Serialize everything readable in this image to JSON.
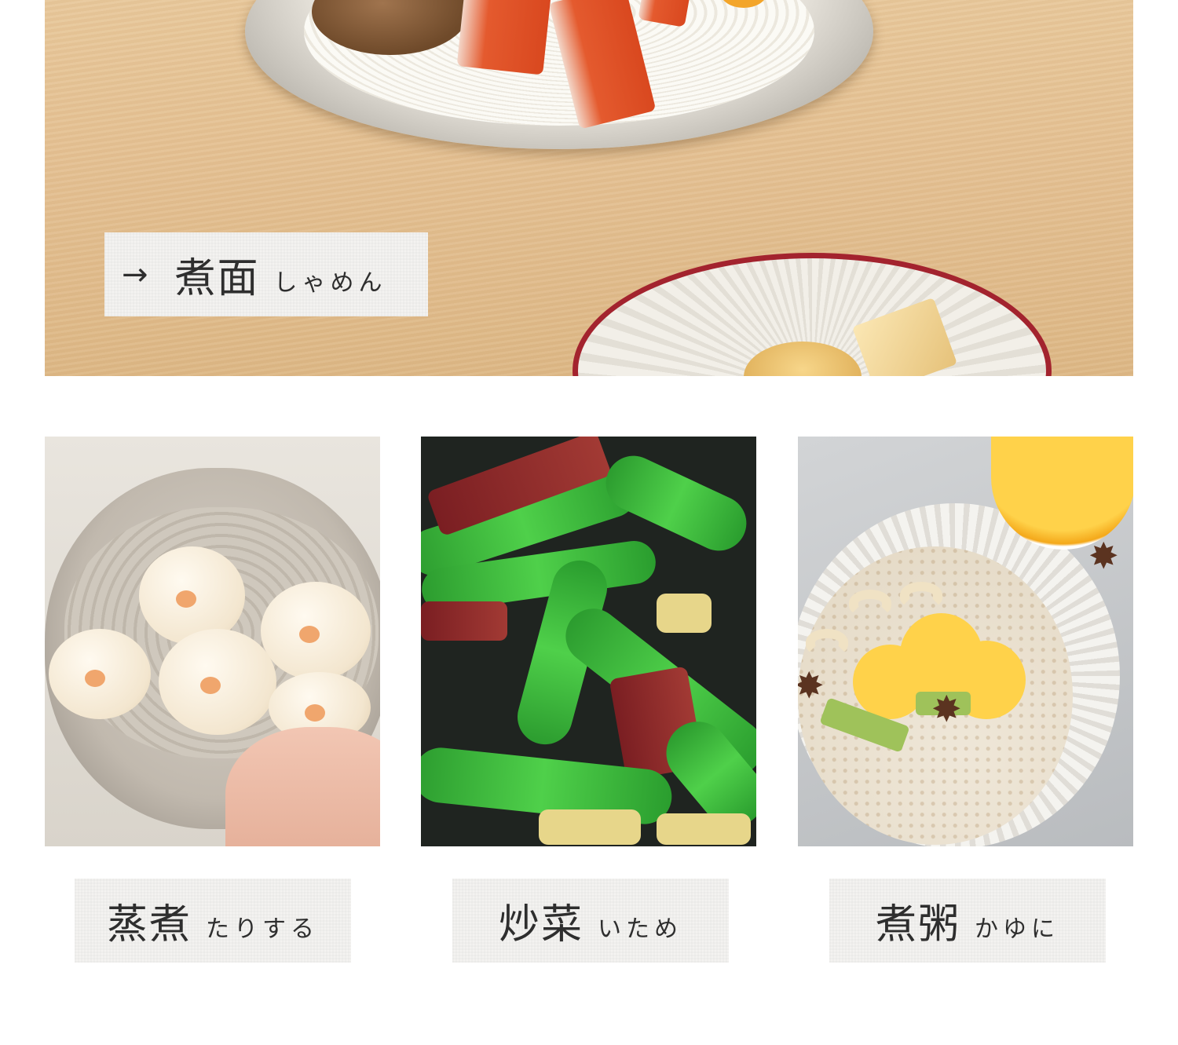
{
  "hero": {
    "label": {
      "arrow": "→",
      "title": "煮面",
      "kana": "しゃめん"
    }
  },
  "tiles": [
    {
      "title": "蒸煮",
      "kana": "たりする"
    },
    {
      "title": "炒菜",
      "kana": "いため"
    },
    {
      "title": "煮粥",
      "kana": "かゆに"
    }
  ],
  "colors": {
    "plate_rim": "#a3232e",
    "label_bg": "#f4f3f1",
    "text": "#2e2e2e"
  }
}
